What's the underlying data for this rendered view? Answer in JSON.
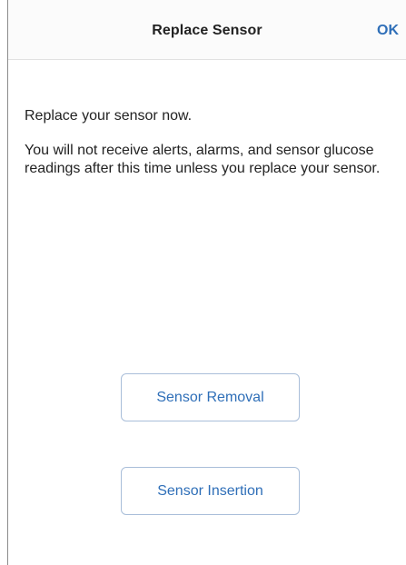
{
  "header": {
    "title": "Replace Sensor",
    "ok_label": "OK"
  },
  "message": {
    "line1": "Replace your sensor now.",
    "line2": "You will not receive alerts, alarms, and sensor glucose readings after this time unless you replace your sensor."
  },
  "actions": {
    "removal_label": "Sensor Removal",
    "insertion_label": "Sensor Insertion"
  },
  "colors": {
    "accent": "#2f6fb8",
    "button_border": "#a9bed9",
    "navbar_bg": "#fbfbfb"
  }
}
